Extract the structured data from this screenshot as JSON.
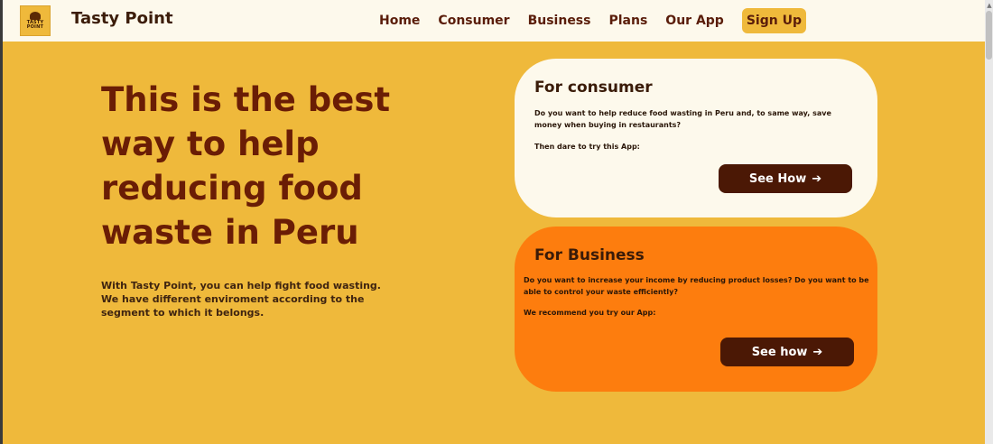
{
  "app": {
    "brand": "Tasty Point",
    "logo_text": "TASTY\nPOINT"
  },
  "nav": {
    "items": [
      {
        "label": "Home"
      },
      {
        "label": "Consumer"
      },
      {
        "label": "Business"
      },
      {
        "label": "Plans"
      },
      {
        "label": "Our App"
      }
    ],
    "signup_label": "Sign Up"
  },
  "hero": {
    "title": "This is the best way to help reducing food waste in Peru",
    "subtitle": "With Tasty Point, you can help fight food wasting. We have different enviroment according to the segment to which it belongs."
  },
  "cards": {
    "consumer": {
      "title": "For consumer",
      "text": "Do you want to help reduce food wasting in Peru and, to same way, save money when buying in restaurants?",
      "cta_text": "Then dare to try this App:",
      "button_label": "See How",
      "button_icon": "arrow-right-icon"
    },
    "business": {
      "title": "For Business",
      "text": "Do you want to increase your income by reducing product losses? Do you want to be able to control your waste efficiently?",
      "cta_text": "We recommend you try our App:",
      "button_label": "See how",
      "button_icon": "arrow-right-icon"
    }
  },
  "colors": {
    "page_bg": "#efb93b",
    "navbar_bg": "#fdf9ec",
    "consumer_card_bg": "#fdf9ec",
    "business_card_bg": "#fd7d0e",
    "button_bg": "#4b1805",
    "title_color": "#6a1d05"
  }
}
